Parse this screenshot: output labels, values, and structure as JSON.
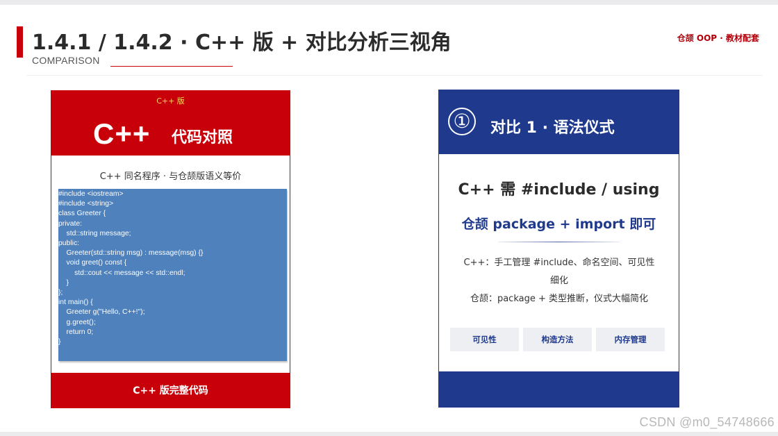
{
  "header": {
    "title": "1.4.1 / 1.4.2 · C++ 版 + 对比分析三视角",
    "subtitle": "COMPARISON",
    "brand": "仓颉 OOP · 教材配套"
  },
  "left_card": {
    "tag": "C++ 版",
    "big_title": "C++",
    "big_subtitle": "代码对照",
    "description": "C++ 同名程序 · 与仓颉版语义等价",
    "code_lines": [
      "#include <iostream>",
      "#include <string>",
      "class Greeter {",
      "private:",
      "    std::string message;",
      "public:",
      "    Greeter(std::string msg) : message(msg) {}",
      "    void greet() const {",
      "        std::cout << message << std::endl;",
      "    }",
      "};",
      "int main() {",
      "    Greeter g(\"Hello, C++!\");",
      "    g.greet();",
      "    return 0;",
      "}"
    ],
    "footer": "C++ 版完整代码"
  },
  "right_card": {
    "number": "①",
    "title": "对比 1 · 语法仪式",
    "line1": "C++ 需 #include / using",
    "line2": "仓颉 package + import 即可",
    "body_lines": [
      "C++：手工管理 #include、命名空间、可见性",
      "细化",
      "仓颉：package + 类型推断，仪式大幅简化"
    ],
    "tags": [
      "可见性",
      "构造方法",
      "内存管理"
    ]
  },
  "watermark": "CSDN @m0_54748666",
  "colors": {
    "accent_red": "#c8000a",
    "navy": "#1f3a8c",
    "code_blue": "#4f81bd",
    "tag_bg": "#eeeff2"
  }
}
